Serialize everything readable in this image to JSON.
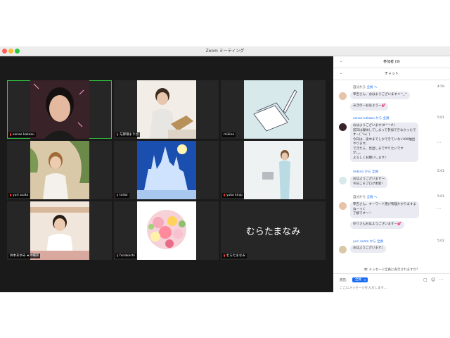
{
  "window": {
    "title": "Zoom ミーティング"
  },
  "participants": [
    {
      "name": "sanae kakazu",
      "active": true
    },
    {
      "name": "与那嶺まりか"
    },
    {
      "name": "mikino"
    },
    {
      "name": "yuri asato"
    },
    {
      "name": "toitoi"
    },
    {
      "name": "yuko kinjo"
    },
    {
      "name": "井本あゆみ ★沖縄県"
    },
    {
      "name": "funakoshi"
    },
    {
      "name": "むらたまなみ",
      "display": "むらたまなみ"
    }
  ],
  "panel": {
    "participants_title": "参加者 (9)",
    "chat_title": "チャット"
  },
  "chat": {
    "messages": [
      {
        "sender_prefix": "自分から",
        "sender": "全員 へ",
        "time": "4:59",
        "bubbles": [
          "宰吉さん、おはようございます＊^_^"
        ]
      },
      {
        "bubbles": [
          "みきのーおはようー💕"
        ]
      },
      {
        "sender": "sanae kakazu から 全員",
        "time": "5:01",
        "bubbles": [
          "おはようございます(#^^#)\n前日は寝坊してしまって参加できなかったで\nすー(´°ω;`)\n今日は、途中までしかできていないKW抽出\nやります。\nできたら、見出しまでやりたいです\nが。。。\nよろしくお願いします♪"
        ]
      },
      {
        "sender": "mikino から 全員",
        "time": "5:01",
        "bubbles": [
          "おはようございます〜\n今日こそブログ更新！"
        ]
      },
      {
        "sender_prefix": "自分から",
        "sender": "全員 へ",
        "time": "5:01",
        "bubbles": [
          "宰吉さん、キーワード選び物理かかりますよ\nねーっく\n了解です〜♡",
          "ゆりさんおはようございますー💕"
        ]
      },
      {
        "sender": "yuri asato から 全員",
        "time": "5:02",
        "bubbles": [
          "おはようございます♪"
        ]
      }
    ],
    "hint": "メッセージ全員に表示されますか？",
    "to_label": "宛先:",
    "to_value": "全員",
    "input_placeholder": "ここにメッセージを入力します..."
  },
  "colors": {
    "accent": "#1b6ef3",
    "active_border": "#2ecc40",
    "bg": "#1a1a1a"
  }
}
